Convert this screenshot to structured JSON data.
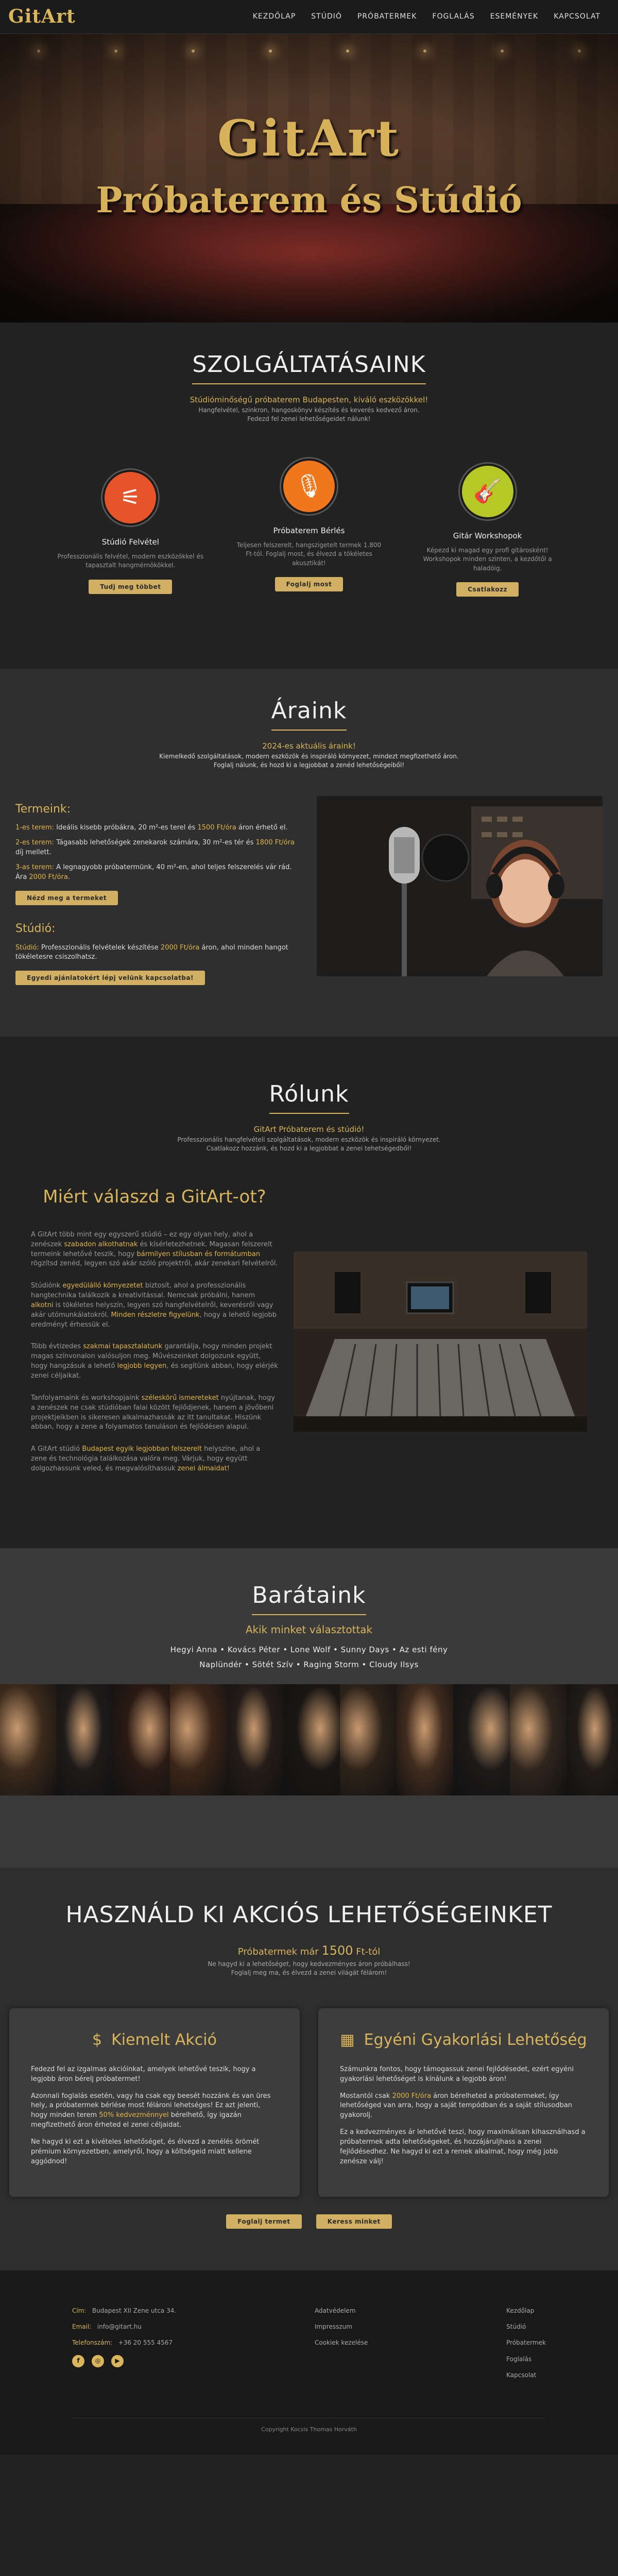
{
  "nav": {
    "logo": "GitArt",
    "links": [
      "KEZDŐLAP",
      "STÚDIÓ",
      "PRÓBATERMEK",
      "FOGLALÁS",
      "ESEMÉNYEK",
      "KAPCSOLAT"
    ]
  },
  "hero": {
    "title": "GitArt",
    "subtitle": "Próbaterem és Stúdió"
  },
  "services": {
    "title": "SZOLGÁLTATÁSAINK",
    "tagline": "Stúdióminőségű próbaterem Budapesten, kiváló eszközökkel!",
    "desc1": "Hangfelvétel, szinkron, hangoskönyv készítés és keverés kedvező áron.",
    "desc2": "Fedezd fel zenei lehetőségeidet nálunk!",
    "items": [
      {
        "icon": "mixer-icon",
        "title": "Stúdió Felvétel",
        "text": "Professzionális felvétel, modern eszközökkel és tapasztalt hangmérnökökkel.",
        "button": "Tudj meg többet",
        "color": "#e8542a"
      },
      {
        "icon": "microphone-icon",
        "title": "Próbaterem Bérlés",
        "text": "Teljesen felszerelt, hangszigetelt termek 1.800 Ft-tól. Foglalj most, és élvezd a tökéletes akusztikát!",
        "button": "Foglalj most",
        "color": "#f0771c"
      },
      {
        "icon": "guitar-icon",
        "title": "Gitár Workshopok",
        "text": "Képezd ki magad egy profi gitárosként! Workshopok minden szinten, a kezdőtől a haladóig.",
        "button": "Csatlakozz",
        "color": "#b6c826"
      }
    ]
  },
  "prices": {
    "title": "Áraink",
    "tagline": "2024-es aktuális áraink!",
    "desc1": "Kiemelkedő szolgáltatások, modern eszközök és inspiráló környezet, mindezt megfizethető áron.",
    "desc2": "Foglalj nálunk, és hozd ki a legjobbat a zenéd lehetőségeiből!",
    "rooms_heading": "Termeink:",
    "room1_label": "1-es terem:",
    "room1_text": " Ideális kisebb próbákra, 20 m²-es terel és ",
    "room1_price": "1500 Ft/óra",
    "room1_end": " áron érhető el.",
    "room2_label": "2-es terem:",
    "room2_text": " Tágasabb lehetőségek zenekarok számára, 30 m²-es tér és ",
    "room2_price": "1800 Ft/óra",
    "room2_end": " díj mellett.",
    "room3_label": "3-as terem:",
    "room3_text": " A legnagyobb próbatermünk, 40 m²-en, ahol teljes felszerelés vár rád. Ára ",
    "room3_price": "2000 Ft/óra",
    "room3_end": ".",
    "rooms_button": "Nézd meg a termeket",
    "studio_heading": "Stúdió:",
    "studio_label": "Stúdió:",
    "studio_text": " Professzionális felvételek készítése ",
    "studio_price": "2000 Ft/óra",
    "studio_end": " áron, ahol minden hangot tökéletesre csiszolhatsz.",
    "studio_button": "Egyedi ajánlatokért lépj velünk kapcsolatba!"
  },
  "about": {
    "title": "Rólunk",
    "tagline": "GitArt Próbaterem és stúdió!",
    "desc1": "Professzionális hangfelvételi szolgáltatások, modern eszközök és inspiráló környezet.",
    "desc2": "Csatlakozz hozzánk, és hozd ki a legjobbat a zenei tehetségedből!",
    "why_title": "Miért válaszd a GitArt-ot?",
    "p1a": "A GitArt több mint egy egyszerű stúdió – ez egy olyan hely, ahol a zenészek ",
    "p1b": "szabadon alkothatnak",
    "p1c": " és kísérletezhetnek. Magasan felszerelt termeink lehetővé teszik, hogy ",
    "p1d": "bármilyen stílusban és formátumban",
    "p1e": " rögzítsd zenéd, legyen szó akár szóló projektről, akár zenekari felvételről.",
    "p2a": "Stúdiónk ",
    "p2b": "egyedülálló környezetet",
    "p2c": " biztosít, ahol a professzionális hangtechnika találkozik a kreativitással. Nemcsak próbálni, hanem ",
    "p2d": "alkotni",
    "p2e": " is tökéletes helyszín, legyen szó hangfelvételről, keverésről vagy akár utómunkálatokról. ",
    "p2f": "Minden részletre figyelünk",
    "p2g": ", hogy a lehető legjobb eredményt érhessük el.",
    "p3a": "Több évtizedes ",
    "p3b": "szakmai tapasztalatunk",
    "p3c": " garantálja, hogy minden projekt magas színvonalon valósuljon meg. Művészeinket dolgozunk együtt, hogy hangzásuk a lehető ",
    "p3d": "legjobb legyen",
    "p3e": ", és segítünk abban, hogy elérjék zenei céljaikat.",
    "p4a": "Tanfolyamaink és workshopjaink ",
    "p4b": "széleskörű ismereteket",
    "p4c": " nyújtanak, hogy a zenészek ne csak stúdióban falai között fejlődjenek, hanem a jövőbeni projektjeikben is sikeresen alkalmazhassák az itt tanultakat. Hiszünk abban, hogy a zene a folyamatos tanuláson és fejlődésen alapul.",
    "p5a": "A GitArt stúdió ",
    "p5b": "Budapest egyik legjobban felszerelt",
    "p5c": " helyszíne, ahol a zene és technológia találkozása valóra meg. Várjuk, hogy együtt dolgozhassunk veled, és megvalósíthassuk ",
    "p5d": "zenei álmaidat!"
  },
  "friends": {
    "title": "Barátaink",
    "tagline": "Akik minket választottak",
    "line1": "Hegyi Anna • Kovács Péter • Lone Wolf • Sunny Days • Az esti fény",
    "line2": "Naplündér • Sötét Szív • Raging Storm • Cloudy Ilsys",
    "photos": [
      "#3b2a1c",
      "#1e1b1a",
      "#2a1a14",
      "#3a2518",
      "#241c18",
      "#1a1613",
      "#2d2219",
      "#3f2b1e",
      "#1c1a19",
      "#2f251d",
      "#201b17"
    ]
  },
  "offers": {
    "title": "HASZNÁLD KI AKCIÓS LEHETŐSÉGEINKET",
    "tagline_pre": "Próbatermek már ",
    "tagline_price": "1500",
    "tagline_post": " Ft-tól",
    "desc1": "Ne hagyd ki a lehetőséget, hogy kedvezményes áron próbálhass!",
    "desc2": "Foglalj meg ma, és élvezd a zenei világát félárom!",
    "card1": {
      "icon": "dollar-icon",
      "title": "Kiemelt Akció",
      "p1": "Fedezd fel az izgalmas akcióinkat, amelyek lehetővé teszik, hogy a legjobb áron bérelj próbatermet!",
      "p2a": "Azonnali foglalás esetén, vagy ha csak egy beesét hozzánk és van üres hely, a próbatermek bérlése most félároni lehetséges! Ez azt jelenti, hogy minden terem ",
      "p2b": "50% kedvezménnyel",
      "p2c": " bérelhető, így igazán megfizethető áron érheted el zenei céljaidat.",
      "p3": "Ne hagyd ki ezt a kivételes lehetőséget, és élvezd a zenélés örömét prémium környezetben, amelyről, hogy a költségeid miatt kellene aggódnod!"
    },
    "card2": {
      "icon": "calendar-icon",
      "title": "Egyéni Gyakorlási Lehetőség",
      "p1": "Számunkra fontos, hogy támogassuk zenei fejlődésedet, ezért egyéni gyakorlási lehetőséget is kínálunk a legjobb áron!",
      "p2a": "Mostantól csak ",
      "p2b": "2000 Ft/óra",
      "p2c": " áron bérelheted a próbatermeket, így lehetőséged van arra, hogy a saját tempódban és a saját stílusodban gyakorolj.",
      "p3": "Ez a kedvezményes ár lehetővé teszi, hogy maximálisan kihasználhasd a próbatermek adta lehetőségeket, és hozzájáruljhass a zenei fejlődésedhez. Ne hagyd ki ezt a remek alkalmat, hogy még jobb zenésze válj!"
    },
    "btn1": "Foglalj termet",
    "btn2": "Keress minket"
  },
  "footer": {
    "address_label": "Cím:",
    "address": "Budapest XII Zene utca 34.",
    "email_label": "Email:",
    "email": "info@gitart.hu",
    "phone_label": "Telefonszám:",
    "phone": "+36 20 555 4567",
    "social": [
      "facebook-icon",
      "instagram-icon",
      "youtube-icon"
    ],
    "col2": [
      "Adatvédelem",
      "Impresszum",
      "Cookiek kezelése"
    ],
    "col3": [
      "Kezdőlap",
      "Stúdió",
      "Próbatermek",
      "Foglalás",
      "Kapcsolat"
    ],
    "copyright": "Copyright Kocsis Thomas Horváth"
  },
  "colors": {
    "accent": "#d9b55b",
    "background": "#222222"
  }
}
